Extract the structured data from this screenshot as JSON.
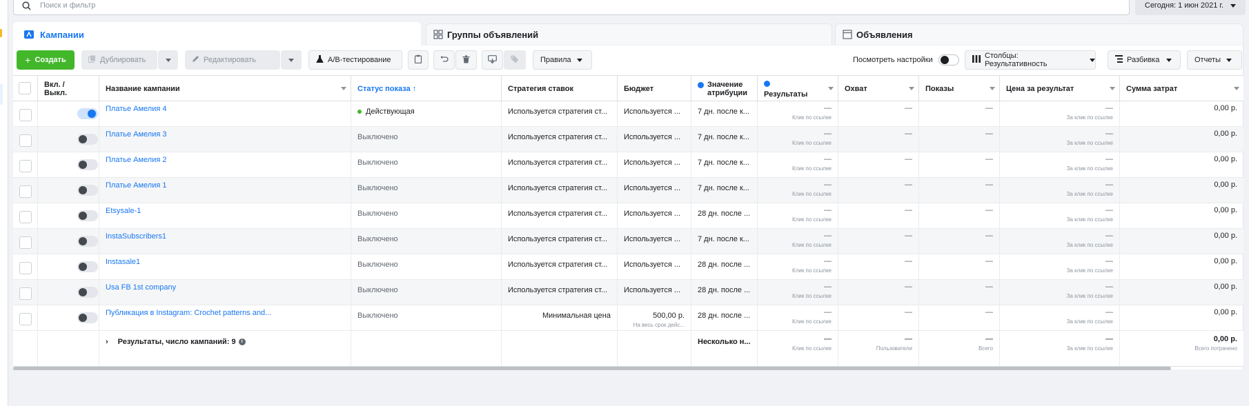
{
  "search": {
    "placeholder": "Поиск и фильтр"
  },
  "date": {
    "label": "Сегодня: 1 июн 2021 г."
  },
  "tabs": [
    {
      "label": "Кампании"
    },
    {
      "label": "Группы объявлений"
    },
    {
      "label": "Объявления"
    }
  ],
  "toolbar": {
    "create": "Создать",
    "duplicate": "Дублировать",
    "edit": "Редактировать",
    "ab_test": "A/B-тестирование",
    "rules": "Правила",
    "view_settings": "Посмотреть настройки",
    "columns": "Столбцы: Результативность",
    "breakdown": "Разбивка",
    "reports": "Отчеты"
  },
  "columns": {
    "onoff": "Вкл. / Выкл.",
    "name": "Название кампании",
    "status": "Статус показа ↑",
    "bid": "Стратегия ставок",
    "budget": "Бюджет",
    "attribution": "Значение атрибуции",
    "results": "Результаты",
    "reach": "Охват",
    "impressions": "Показы",
    "cpr": "Цена за результат",
    "spent": "Сумма затрат"
  },
  "rows": [
    {
      "on": true,
      "name": "Платье Амелия 4",
      "status": "Действующая",
      "bid": "Используется стратегия ст...",
      "budget": "Используется ...",
      "budget_sub": "",
      "attr": "7 дн. после к...",
      "results": "—",
      "results_sub": "Клик по ссылке",
      "reach": "—",
      "impr": "—",
      "cpr": "—",
      "cpr_sub": "За клик по ссылке",
      "spent": "0,00 р."
    },
    {
      "on": false,
      "name": "Платье Амелия 3",
      "status": "Выключено",
      "bid": "Используется стратегия ст...",
      "budget": "Используется ...",
      "budget_sub": "",
      "attr": "7 дн. после к...",
      "results": "—",
      "results_sub": "Клик по ссылке",
      "reach": "—",
      "impr": "—",
      "cpr": "—",
      "cpr_sub": "За клик по ссылке",
      "spent": "0,00 р."
    },
    {
      "on": false,
      "name": "Платье Амелия 2",
      "status": "Выключено",
      "bid": "Используется стратегия ст...",
      "budget": "Используется ...",
      "budget_sub": "",
      "attr": "7 дн. после к...",
      "results": "—",
      "results_sub": "Клик по ссылке",
      "reach": "—",
      "impr": "—",
      "cpr": "—",
      "cpr_sub": "За клик по ссылке",
      "spent": "0,00 р."
    },
    {
      "on": false,
      "name": "Платье Амелия 1",
      "status": "Выключено",
      "bid": "Используется стратегия ст...",
      "budget": "Используется ...",
      "budget_sub": "",
      "attr": "7 дн. после к...",
      "results": "—",
      "results_sub": "Клик по ссылке",
      "reach": "—",
      "impr": "—",
      "cpr": "—",
      "cpr_sub": "За клик по ссылке",
      "spent": "0,00 р."
    },
    {
      "on": false,
      "name": "Etsysale-1",
      "status": "Выключено",
      "bid": "Используется стратегия ст...",
      "budget": "Используется ...",
      "budget_sub": "",
      "attr": "28 дн. после ...",
      "results": "—",
      "results_sub": "Клик по ссылке",
      "reach": "—",
      "impr": "—",
      "cpr": "—",
      "cpr_sub": "За клик по ссылке",
      "spent": "0,00 р."
    },
    {
      "on": false,
      "name": "InstaSubscribers1",
      "status": "Выключено",
      "bid": "Используется стратегия ст...",
      "budget": "Используется ...",
      "budget_sub": "",
      "attr": "7 дн. после к...",
      "results": "—",
      "results_sub": "Клик по ссылке",
      "reach": "—",
      "impr": "—",
      "cpr": "—",
      "cpr_sub": "За клик по ссылке",
      "spent": "0,00 р."
    },
    {
      "on": false,
      "name": "Instasale1",
      "status": "Выключено",
      "bid": "Используется стратегия ст...",
      "budget": "Используется ...",
      "budget_sub": "",
      "attr": "28 дн. после ...",
      "results": "—",
      "results_sub": "Клик по ссылке",
      "reach": "—",
      "impr": "—",
      "cpr": "—",
      "cpr_sub": "За клик по ссылке",
      "spent": "0,00 р."
    },
    {
      "on": false,
      "name": "Usa FB 1st company",
      "status": "Выключено",
      "bid": "Используется стратегия ст...",
      "budget": "Используется ...",
      "budget_sub": "",
      "attr": "28 дн. после ...",
      "results": "—",
      "results_sub": "Клик по ссылке",
      "reach": "—",
      "impr": "—",
      "cpr": "—",
      "cpr_sub": "За клик по ссылке",
      "spent": "0,00 р."
    },
    {
      "on": false,
      "name": "Публикация в Instagram: Crochet patterns and...",
      "status": "Выключено",
      "bid": "Минимальная цена",
      "budget": "500,00 р.",
      "budget_sub": "На весь срок дейс...",
      "attr": "28 дн. после ...",
      "results": "—",
      "results_sub": "Клик по ссылке",
      "reach": "—",
      "impr": "—",
      "cpr": "—",
      "cpr_sub": "За клик по ссылке",
      "spent": "0,00 р."
    }
  ],
  "summary": {
    "title": "Результаты, число кампаний: 9",
    "attr": "Несколько н...",
    "results": "—",
    "results_sub": "Клик по ссылке",
    "reach": "—",
    "reach_sub": "Пользователи",
    "impr": "—",
    "impr_sub": "Всего",
    "cpr": "—",
    "cpr_sub": "За клик по ссылке",
    "spent": "0,00 р.",
    "spent_sub": "Всего потрачено"
  },
  "colors": {
    "accent": "#1877f2",
    "create": "#42b72a"
  }
}
